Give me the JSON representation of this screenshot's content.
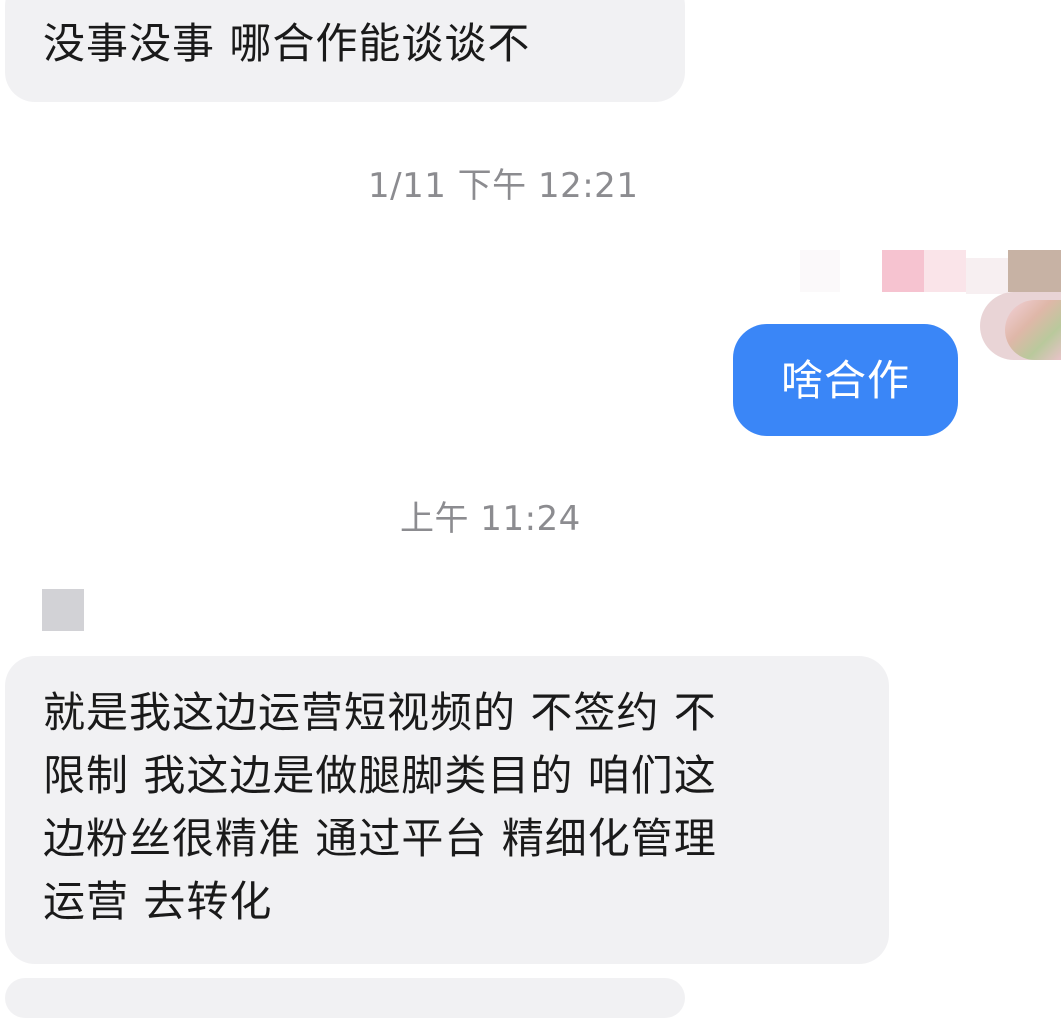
{
  "messages": {
    "first": {
      "text": "没事没事  哪合作能谈谈不"
    },
    "timestamp1": "1/11 下午 12:21",
    "reply": {
      "text": "啥合作"
    },
    "timestamp2": "上午 11:24",
    "long": {
      "lines": [
        "就是我这边运营短视频的 不签约 不",
        "限制  我这边是做腿脚类目的  咱们这",
        "边粉丝很精准  通过平台  精细化管理",
        "运营    去转化"
      ]
    }
  },
  "colors": {
    "incoming_bubble": "#f1f1f3",
    "outgoing_bubble": "#3a86f7",
    "timestamp": "#8c8c90"
  }
}
